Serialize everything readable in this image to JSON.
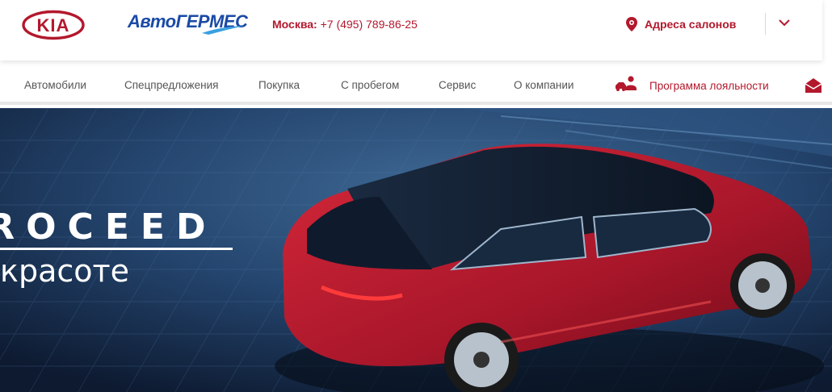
{
  "header": {
    "kia_logo_text": "KIA",
    "dealer_logo_text": "АвтоГЕРМЕС",
    "phone_city": "Москва:",
    "phone_number": "+7 (495) 789-86-25",
    "salons_label": "Адреса салонов"
  },
  "nav": {
    "items": [
      {
        "label": "Автомобили"
      },
      {
        "label": "Спецпредложения"
      },
      {
        "label": "Покупка"
      },
      {
        "label": "С пробегом"
      },
      {
        "label": "Сервис"
      },
      {
        "label": "О компании"
      }
    ],
    "loyalty_label": "Программа лояльности"
  },
  "hero": {
    "title": "PROCEED",
    "subtitle": "красоте"
  },
  "colors": {
    "brand_red": "#b3182d",
    "dealer_blue": "#1a4aa6"
  },
  "icons": {
    "location": "map-pin-icon",
    "chevron": "chevron-down-icon",
    "loyalty": "loyalty-people-icon",
    "mail": "mail-icon"
  }
}
